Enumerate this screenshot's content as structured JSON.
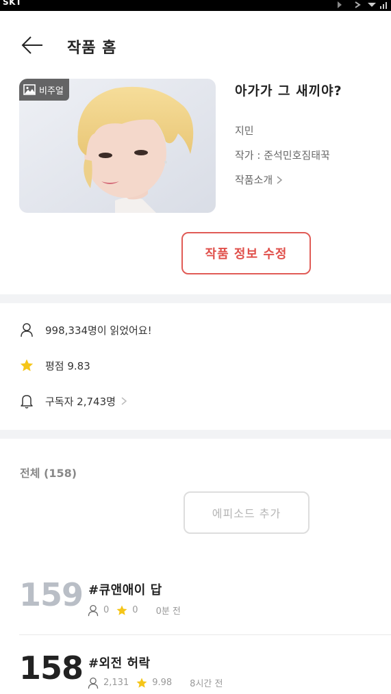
{
  "status_bar": {
    "carrier": "SKT"
  },
  "header": {
    "title": "작품 홈"
  },
  "work": {
    "badge": "비주얼",
    "title": "아가가 그 새끼야?",
    "genre": "지민",
    "author": "작가 : 준석민호짐태꾹",
    "intro_label": "작품소개"
  },
  "edit_button": {
    "label": "작품 정보 수정"
  },
  "stats": {
    "readers": "998,334명이 읽었어요!",
    "rating": "평점 9.83",
    "subscribers": "구독자 2,743명"
  },
  "episodes_section": {
    "total": "전체 (158)",
    "add_label": "에피소드 추가"
  },
  "episodes": [
    {
      "number": "159",
      "title": "#큐앤애이 답",
      "views": "0",
      "rating": "0",
      "time": "0분 전"
    },
    {
      "number": "158",
      "title": "#외전 허락",
      "views": "2,131",
      "rating": "9.98",
      "time": "8시간 전"
    }
  ],
  "colors": {
    "accent": "#e0504b",
    "star": "#f5c518",
    "new_episode_number": "#b9bec6",
    "divider": "#f2f3f5"
  },
  "icons": {
    "back": "arrow-left-icon",
    "badge": "image-icon",
    "readers": "person-icon",
    "rating": "star-icon",
    "subscribers": "bell-icon",
    "chevron": "chevron-right-icon"
  }
}
